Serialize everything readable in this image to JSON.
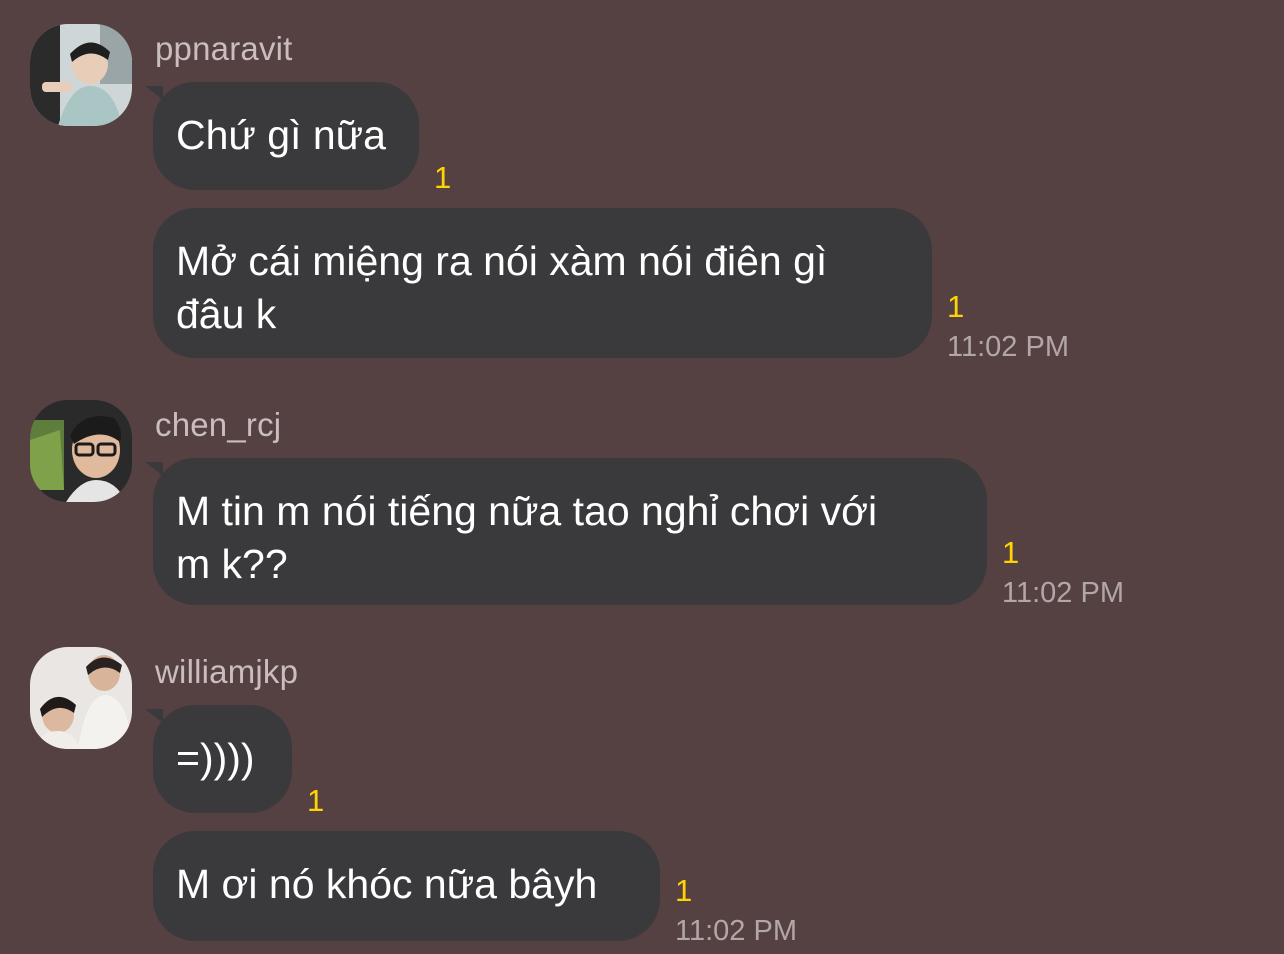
{
  "messages": [
    {
      "sender": "ppnaravit",
      "bubbles": [
        {
          "text": "Chứ gì nữa",
          "unread": "1",
          "time": ""
        },
        {
          "text": "Mở cái miệng ra nói xàm nói điên gì\nđâu k",
          "unread": "1",
          "time": "11:02 PM"
        }
      ]
    },
    {
      "sender": "chen_rcj",
      "bubbles": [
        {
          "text": "M tin m nói tiếng nữa tao nghỉ chơi với\nm k??",
          "unread": "1",
          "time": "11:02 PM"
        }
      ]
    },
    {
      "sender": "williamjkp",
      "bubbles": [
        {
          "text": "=))))",
          "unread": "1",
          "time": ""
        },
        {
          "text": "M ơi nó khóc nữa bâyh",
          "unread": "1",
          "time": "11:02 PM"
        }
      ]
    }
  ],
  "icons": {
    "avatar_1": "avatar-photo",
    "avatar_2": "avatar-photo",
    "avatar_3": "avatar-photo"
  },
  "colors": {
    "background": "#564142",
    "bubble": "#3a3a3c",
    "unread": "#ffd400"
  }
}
